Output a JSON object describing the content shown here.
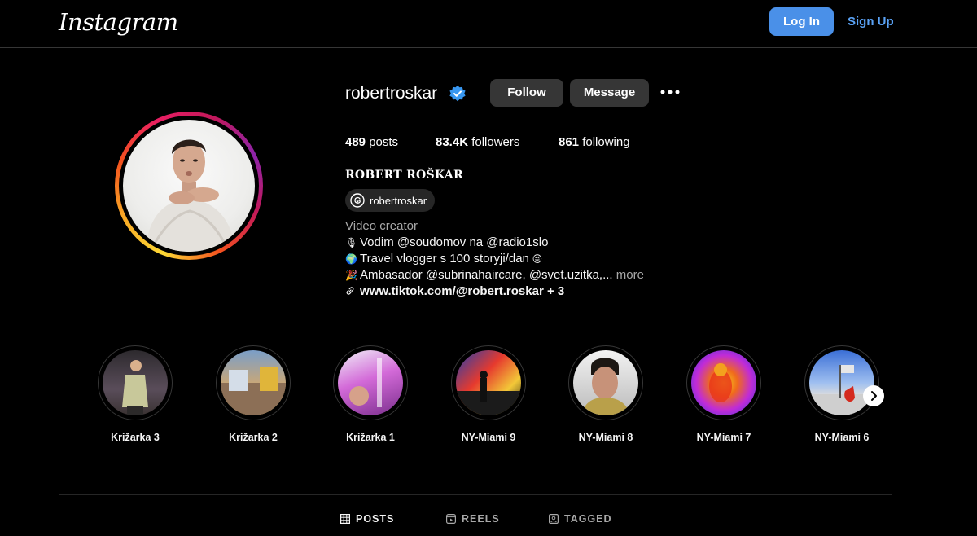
{
  "topbar": {
    "logo": "Instagram",
    "login_label": "Log In",
    "signup_label": "Sign Up"
  },
  "profile": {
    "username": "robertroskar",
    "verified": true,
    "follow_label": "Follow",
    "message_label": "Message",
    "stats": {
      "posts": "489",
      "posts_label": "posts",
      "followers": "83.4K",
      "followers_label": "followers",
      "following": "861",
      "following_label": "following"
    },
    "full_name": "ROBERT ROŠKAR",
    "threads_handle": "robertroskar",
    "category": "Video creator",
    "bio_lines": [
      "Vodim @soudomov na @radio1slo",
      "Travel vlogger s 100 storyji/dan",
      "Ambasador @subrinahaircare, @svet.uzitka,..."
    ],
    "more_label": "more",
    "link": "www.tiktok.com/@robert.roskar + 3"
  },
  "highlights": [
    {
      "label": "Križarka 3"
    },
    {
      "label": "Križarka 2"
    },
    {
      "label": "Križarka 1"
    },
    {
      "label": "NY-Miami 9"
    },
    {
      "label": "NY-Miami 8"
    },
    {
      "label": "NY-Miami 7"
    },
    {
      "label": "NY-Miami 6"
    }
  ],
  "tabs": [
    {
      "label": "POSTS",
      "active": true
    },
    {
      "label": "REELS",
      "active": false
    },
    {
      "label": "TAGGED",
      "active": false
    }
  ],
  "colors": {
    "background": "#000000",
    "primary_button": "#4a90e8",
    "link_blue": "#5aa2f5",
    "secondary_button": "#363636",
    "verified": "#3897f0"
  }
}
